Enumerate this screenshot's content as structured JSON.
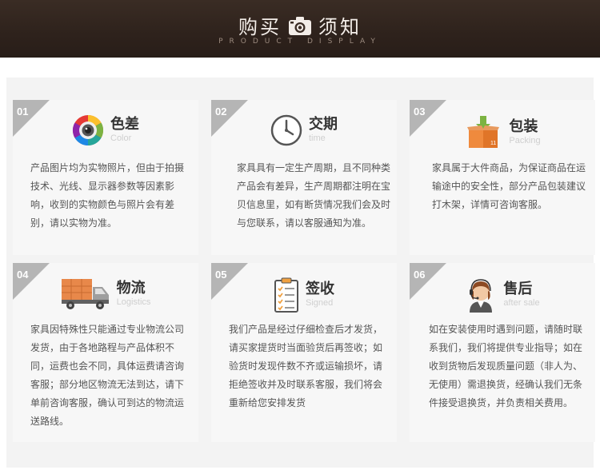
{
  "banner": {
    "title_left": "购买",
    "title_right": "须知",
    "icon": "camera-icon",
    "subtitle": "PRODUCT DISPLAY"
  },
  "cards": [
    {
      "num": "01",
      "title": "色差",
      "en": "Color",
      "icon": "color-wheel-icon",
      "desc": "产品图片均为实物照片，但由于拍摄技术、光线、显示器参数等因素影响，收到的实物颜色与照片会有差别，请以实物为准。"
    },
    {
      "num": "02",
      "title": "交期",
      "en": "time",
      "icon": "clock-icon",
      "desc": "家具具有一定生产周期，且不同种类产品会有差异，生产周期都注明在宝贝信息里，如有断货情况我们会及时与您联系，请以客服通知为准。"
    },
    {
      "num": "03",
      "title": "包装",
      "en": "Packing",
      "icon": "package-box-icon",
      "desc": "家具属于大件商品，为保证商品在运输途中的安全性，部分产品包装建议打木架，详情可咨询客服。"
    },
    {
      "num": "04",
      "title": "物流",
      "en": "Logistics",
      "icon": "delivery-truck-icon",
      "desc": "家具因特殊性只能通过专业物流公司发货，由于各地路程与产品体积不同，运费也会不同，具体运费请咨询客服；部分地区物流无法到达，请下单前咨询客服，确认可到达的物流运送路线。"
    },
    {
      "num": "05",
      "title": "签收",
      "en": "Signed",
      "icon": "clipboard-checklist-icon",
      "desc": "我们产品是经过仔细检查后才发货，请买家提货时当面验货后再签收；如验货时发现件数不齐或运输损坏，请拒绝签收并及时联系客服，我们将会重新给您安排发货"
    },
    {
      "num": "06",
      "title": "售后",
      "en": "after sale",
      "icon": "customer-service-icon",
      "desc": "如在安装使用时遇到问题，请随时联系我们，我们将提供专业指导；如在收到货物后发现质量问题（非人为、无使用）需退换货，经确认我们无条件接受退换货，并负责相关费用。"
    }
  ]
}
